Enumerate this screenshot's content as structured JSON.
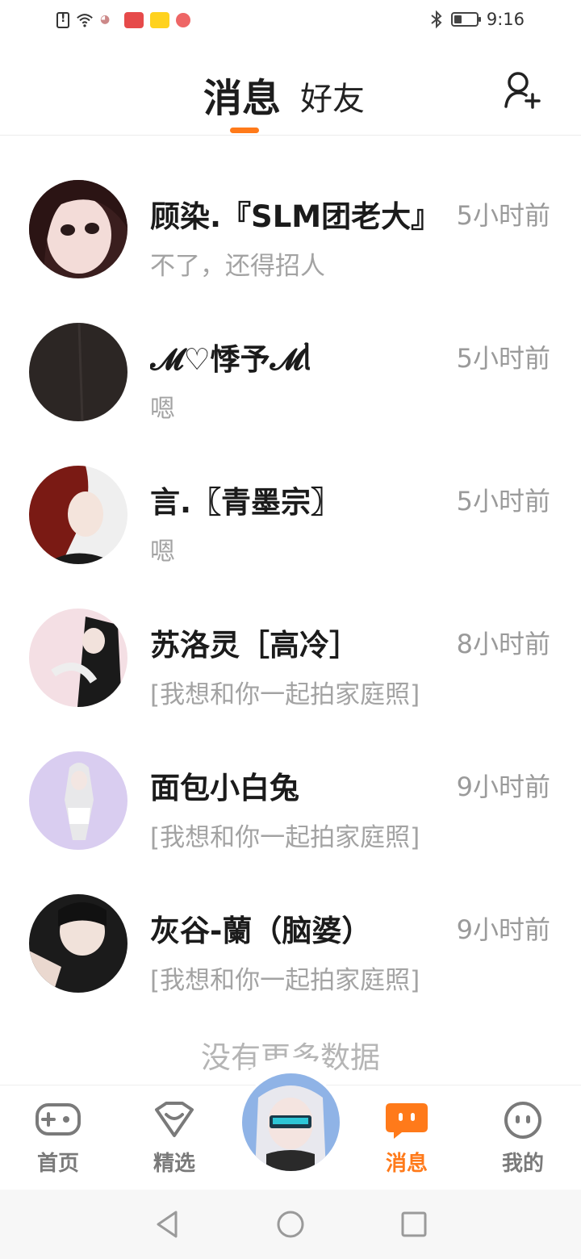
{
  "status_bar": {
    "time": "9:16"
  },
  "header": {
    "tab_active": "消息",
    "tab_inactive": "好友",
    "colors": {
      "accent": "#ff7a1a"
    }
  },
  "messages": [
    {
      "name": "顾染.『SLM团老大』",
      "time": "5小时前",
      "preview": "不了，还得招人"
    },
    {
      "name": "𝓜♡悸予𝓜ᥣ",
      "time": "5小时前",
      "preview": "嗯"
    },
    {
      "name": "言.〖青墨宗〗",
      "time": "5小时前",
      "preview": "嗯"
    },
    {
      "name": "苏洛灵［高冷］",
      "time": "8小时前",
      "preview": "[我想和你一起拍家庭照]"
    },
    {
      "name": "面包小白兔",
      "time": "9小时前",
      "preview": "[我想和你一起拍家庭照]"
    },
    {
      "name": "灰谷-蘭（脑婆）",
      "time": "9小时前",
      "preview": "[我想和你一起拍家庭照]"
    }
  ],
  "footer_note": "没有更多数据",
  "bottom_nav": {
    "items": [
      {
        "label": "首页",
        "icon": "gamepad-icon"
      },
      {
        "label": "精选",
        "icon": "heart-diamond-icon"
      },
      {
        "label": "消息",
        "icon": "chat-bubble-icon",
        "active": true
      },
      {
        "label": "我的",
        "icon": "smiley-face-icon"
      }
    ]
  }
}
